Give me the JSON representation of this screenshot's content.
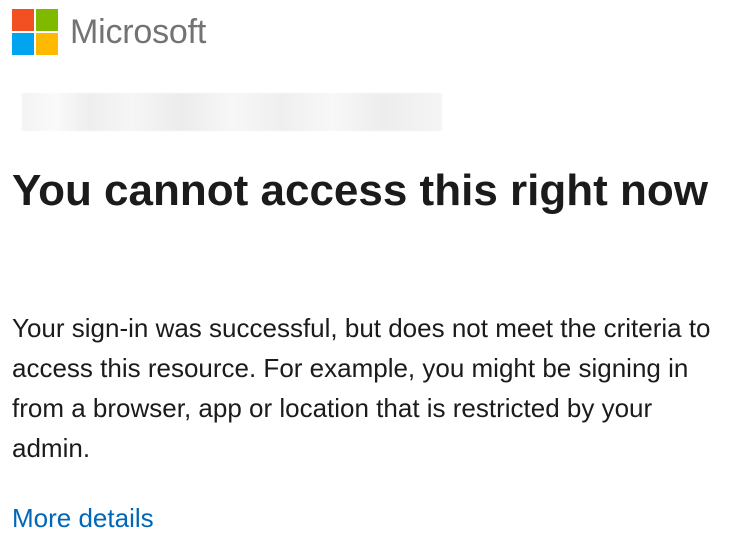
{
  "brand": {
    "logo_icon": "microsoft-logo-icon",
    "logo_colors": [
      "#f25022",
      "#7fba00",
      "#00a4ef",
      "#ffb900"
    ],
    "wordmark": "Microsoft"
  },
  "account": {
    "identity": ""
  },
  "main": {
    "title": "You cannot access this right now",
    "message": "Your sign-in was successful, but does not meet the criteria to access this resource. For example, you might be signing in from a browser, app or location that is restricted by your admin.",
    "more_details_link": "More details"
  },
  "colors": {
    "text": "#1b1b1b",
    "wordmark": "#737373",
    "link": "#0067b8",
    "background": "#ffffff"
  }
}
